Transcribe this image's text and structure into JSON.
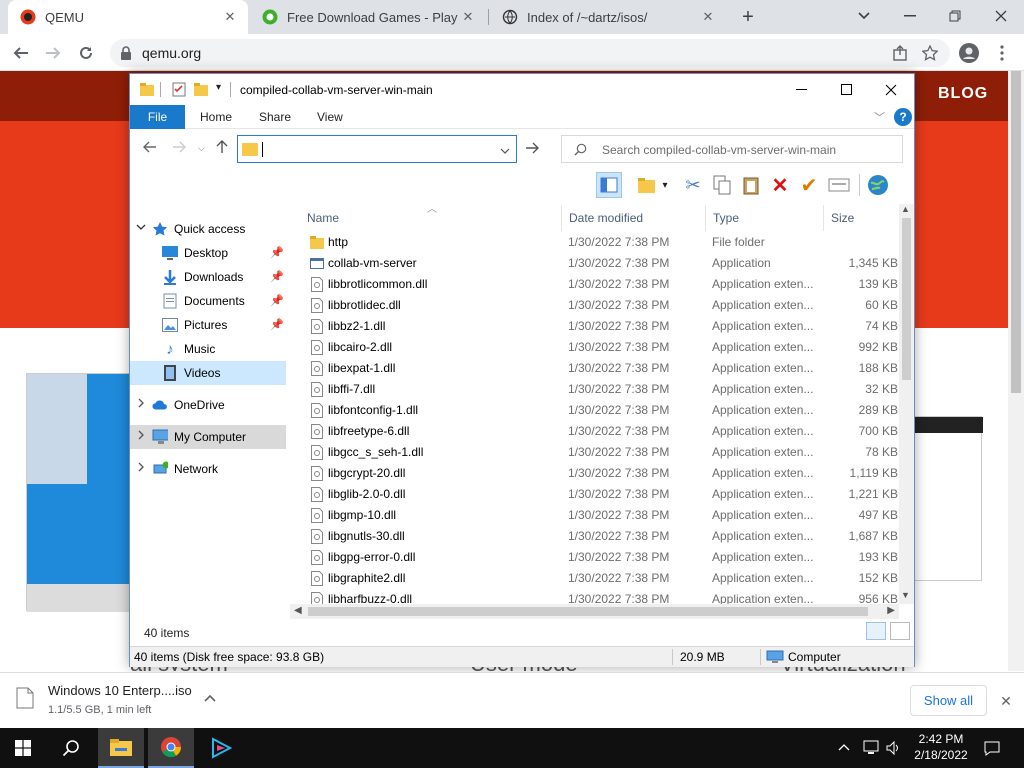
{
  "browser": {
    "tabs": [
      {
        "title": "QEMU",
        "active": true
      },
      {
        "title": "Free Download Games - Play Th",
        "active": false
      },
      {
        "title": "Index of /~dartz/isos/",
        "active": false
      }
    ],
    "new_tab": "+",
    "url": "qemu.org"
  },
  "site": {
    "nav_blog": "BLOG",
    "bottom_text_1": "all system",
    "bottom_text_2": "User mode",
    "bottom_text_3": "Virtualization"
  },
  "explorer": {
    "title": "compiled-collab-vm-server-win-main",
    "ribbon": {
      "file": "File",
      "home": "Home",
      "share": "Share",
      "view": "View",
      "help": "?"
    },
    "address_value": "",
    "search_placeholder": "Search compiled-collab-vm-server-win-main",
    "nav": {
      "quick_access": "Quick access",
      "desktop": "Desktop",
      "downloads": "Downloads",
      "documents": "Documents",
      "pictures": "Pictures",
      "music": "Music",
      "videos": "Videos",
      "onedrive": "OneDrive",
      "my_computer": "My Computer",
      "network": "Network"
    },
    "columns": {
      "name": "Name",
      "date": "Date modified",
      "type": "Type",
      "size": "Size"
    },
    "files": [
      {
        "name": "http",
        "date": "1/30/2022 7:38 PM",
        "type": "File folder",
        "size": "",
        "kind": "folder"
      },
      {
        "name": "collab-vm-server",
        "date": "1/30/2022 7:38 PM",
        "type": "Application",
        "size": "1,345 KB",
        "kind": "app"
      },
      {
        "name": "libbrotlicommon.dll",
        "date": "1/30/2022 7:38 PM",
        "type": "Application exten...",
        "size": "139 KB",
        "kind": "dll"
      },
      {
        "name": "libbrotlidec.dll",
        "date": "1/30/2022 7:38 PM",
        "type": "Application exten...",
        "size": "60 KB",
        "kind": "dll"
      },
      {
        "name": "libbz2-1.dll",
        "date": "1/30/2022 7:38 PM",
        "type": "Application exten...",
        "size": "74 KB",
        "kind": "dll"
      },
      {
        "name": "libcairo-2.dll",
        "date": "1/30/2022 7:38 PM",
        "type": "Application exten...",
        "size": "992 KB",
        "kind": "dll"
      },
      {
        "name": "libexpat-1.dll",
        "date": "1/30/2022 7:38 PM",
        "type": "Application exten...",
        "size": "188 KB",
        "kind": "dll"
      },
      {
        "name": "libffi-7.dll",
        "date": "1/30/2022 7:38 PM",
        "type": "Application exten...",
        "size": "32 KB",
        "kind": "dll"
      },
      {
        "name": "libfontconfig-1.dll",
        "date": "1/30/2022 7:38 PM",
        "type": "Application exten...",
        "size": "289 KB",
        "kind": "dll"
      },
      {
        "name": "libfreetype-6.dll",
        "date": "1/30/2022 7:38 PM",
        "type": "Application exten...",
        "size": "700 KB",
        "kind": "dll"
      },
      {
        "name": "libgcc_s_seh-1.dll",
        "date": "1/30/2022 7:38 PM",
        "type": "Application exten...",
        "size": "78 KB",
        "kind": "dll"
      },
      {
        "name": "libgcrypt-20.dll",
        "date": "1/30/2022 7:38 PM",
        "type": "Application exten...",
        "size": "1,119 KB",
        "kind": "dll"
      },
      {
        "name": "libglib-2.0-0.dll",
        "date": "1/30/2022 7:38 PM",
        "type": "Application exten...",
        "size": "1,221 KB",
        "kind": "dll"
      },
      {
        "name": "libgmp-10.dll",
        "date": "1/30/2022 7:38 PM",
        "type": "Application exten...",
        "size": "497 KB",
        "kind": "dll"
      },
      {
        "name": "libgnutls-30.dll",
        "date": "1/30/2022 7:38 PM",
        "type": "Application exten...",
        "size": "1,687 KB",
        "kind": "dll"
      },
      {
        "name": "libgpg-error-0.dll",
        "date": "1/30/2022 7:38 PM",
        "type": "Application exten...",
        "size": "193 KB",
        "kind": "dll"
      },
      {
        "name": "libgraphite2.dll",
        "date": "1/30/2022 7:38 PM",
        "type": "Application exten...",
        "size": "152 KB",
        "kind": "dll"
      },
      {
        "name": "libharfbuzz-0.dll",
        "date": "1/30/2022 7:38 PM",
        "type": "Application exten...",
        "size": "956 KB",
        "kind": "dll"
      }
    ],
    "item_count": "40 items",
    "status": {
      "left": "40 items (Disk free space: 93.8 GB)",
      "size": "20.9 MB",
      "location": "Computer"
    }
  },
  "download": {
    "name": "Windows 10 Enterp....iso",
    "status": "1.1/5.5 GB, 1 min left",
    "show_all": "Show all"
  },
  "taskbar": {
    "time": "2:42 PM",
    "date": "2/18/2022"
  },
  "colors": {
    "accent": "#1979ca",
    "site_red": "#e63a1b",
    "site_dark": "#8e1e07"
  }
}
